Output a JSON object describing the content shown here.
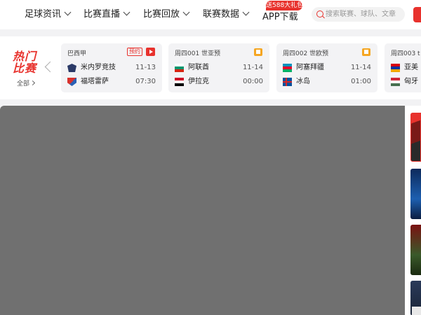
{
  "nav": {
    "items": [
      {
        "label": "足球资讯"
      },
      {
        "label": "比赛直播"
      },
      {
        "label": "比赛回放"
      },
      {
        "label": "联赛数据"
      }
    ],
    "app": {
      "label": "APP下载",
      "badge": "送588大礼包"
    },
    "search": {
      "placeholder": "搜索联赛、球队、文章"
    }
  },
  "hot": {
    "title_line1": "热门",
    "title_line2": "比赛",
    "all_label": "全部"
  },
  "matches": [
    {
      "league": "巴西甲",
      "tag": "预约",
      "icon": "play-icon",
      "home": {
        "name": "米内罗竞技",
        "value": "11-13",
        "logo": "crest-a"
      },
      "away": {
        "name": "福塔雷萨",
        "value": "07:30",
        "logo": "crest-b"
      }
    },
    {
      "league": "周四001 世亚预",
      "icon": "chat-icon",
      "home": {
        "name": "阿联酋",
        "value": "11-14",
        "logo": "flag-bulgaria"
      },
      "away": {
        "name": "伊拉克",
        "value": "00:00",
        "logo": "flag-egypt"
      }
    },
    {
      "league": "周四002 世欧预",
      "icon": "chat-icon",
      "home": {
        "name": "阿塞拜疆",
        "value": "11-14",
        "logo": "flag-azerbaijan"
      },
      "away": {
        "name": "冰岛",
        "value": "01:00",
        "logo": "flag-iceland"
      }
    },
    {
      "league": "周四003 t",
      "home": {
        "name": "亚美",
        "value": "",
        "logo": "flag-armenia"
      },
      "away": {
        "name": "匈牙",
        "value": "",
        "logo": "flag-hungary"
      }
    }
  ],
  "colors": {
    "accent": "#e8322d",
    "panel": "#707070"
  }
}
